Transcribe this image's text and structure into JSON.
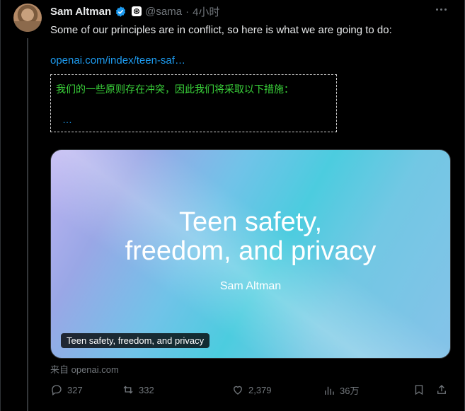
{
  "post": {
    "author_name": "Sam Altman",
    "handle": "@sama",
    "separator": "·",
    "time": "4小时",
    "text": "Some of our principles are in conflict, so here is what we are going to do:",
    "link": "openai.com/index/teen-saf…",
    "translation": "我们的一些原则存在冲突，因此我们将采取以下措施：",
    "translation_more": "…",
    "card": {
      "title_line1": "Teen safety,",
      "title_line2": "freedom, and privacy",
      "author": "Sam Altman",
      "caption": "Teen safety, freedom, and privacy"
    },
    "source": "来自 openai.com",
    "stats": {
      "replies": "327",
      "reposts": "332",
      "likes": "2,379",
      "views": "36万"
    }
  },
  "icons": {
    "verified": "verified-badge-icon",
    "affiliate": "openai-logo-icon",
    "more": "more-icon",
    "reply": "reply-icon",
    "repost": "repost-icon",
    "like": "heart-icon",
    "views": "views-icon",
    "bookmark": "bookmark-icon",
    "share": "share-icon"
  },
  "colors": {
    "background": "#000000",
    "link": "#1d9bf0",
    "translation": "#3ad33a",
    "muted": "#71767b"
  }
}
